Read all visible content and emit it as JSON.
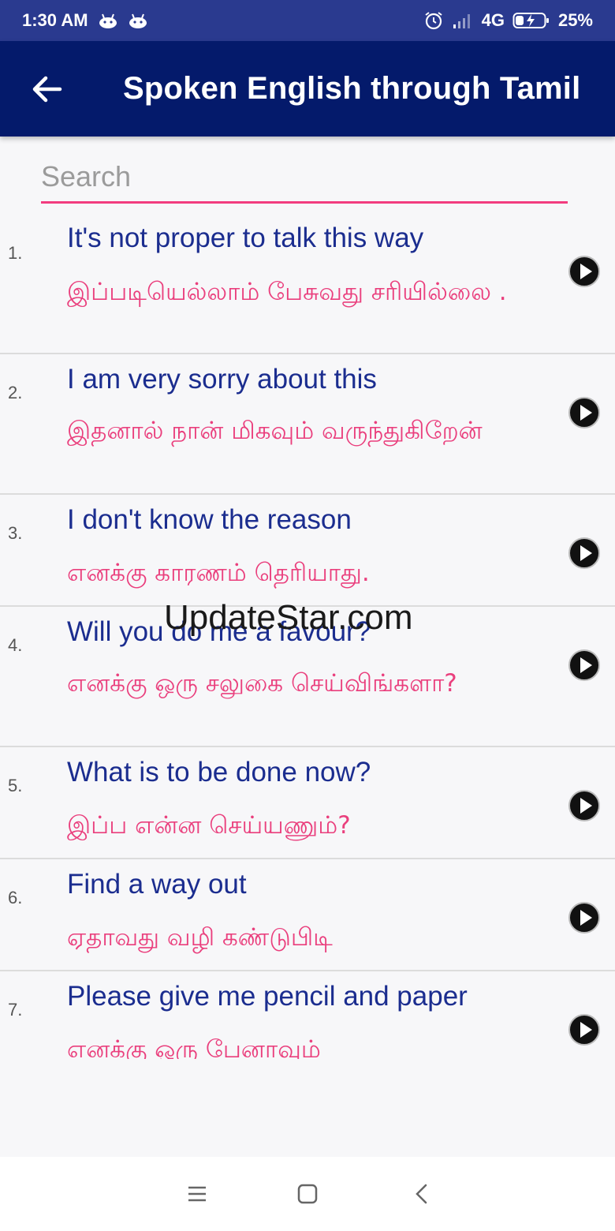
{
  "status_bar": {
    "time": "1:30 AM",
    "network": "4G",
    "battery": "25%"
  },
  "app_bar": {
    "title": "Spoken English through Tamil"
  },
  "search": {
    "placeholder": "Search",
    "value": ""
  },
  "phrases": [
    {
      "num": "1.",
      "english": "It's not proper to talk this way",
      "tamil": "இப்படியெல்லாம் பேசுவது சரியில்லை ."
    },
    {
      "num": "2.",
      "english": "I am very sorry about this",
      "tamil": "இதனால் நான் மிகவும் வருந்துகிறேன்"
    },
    {
      "num": "3.",
      "english": "I don't know the reason",
      "tamil": "எனக்கு காரணம் தெரியாது."
    },
    {
      "num": "4.",
      "english": "Will you do me a favour?",
      "tamil": "எனக்கு ஒரு சலுகை செய்விங்களா?"
    },
    {
      "num": "5.",
      "english": "What is to be done now?",
      "tamil": "இப்ப என்ன செய்யணும்?"
    },
    {
      "num": "6.",
      "english": "Find a way out",
      "tamil": "ஏதாவது வழி கண்டுபிடி"
    },
    {
      "num": "7.",
      "english": "Please give me pencil and paper",
      "tamil": "எனக்கு ஒரு பேனாவும்"
    }
  ],
  "watermark": "UpdateStar.com",
  "icons": {
    "back": "arrow-left-icon",
    "play": "play-circle-icon",
    "nav_menu": "menu-icon",
    "nav_home": "square-home-icon",
    "nav_back": "chevron-left-icon"
  },
  "colors": {
    "status_bar": "#2a3a8f",
    "app_bar": "#041a6b",
    "english_text": "#1b2d8f",
    "tamil_text": "#ea3f7d",
    "search_underline": "#f23c7f"
  }
}
